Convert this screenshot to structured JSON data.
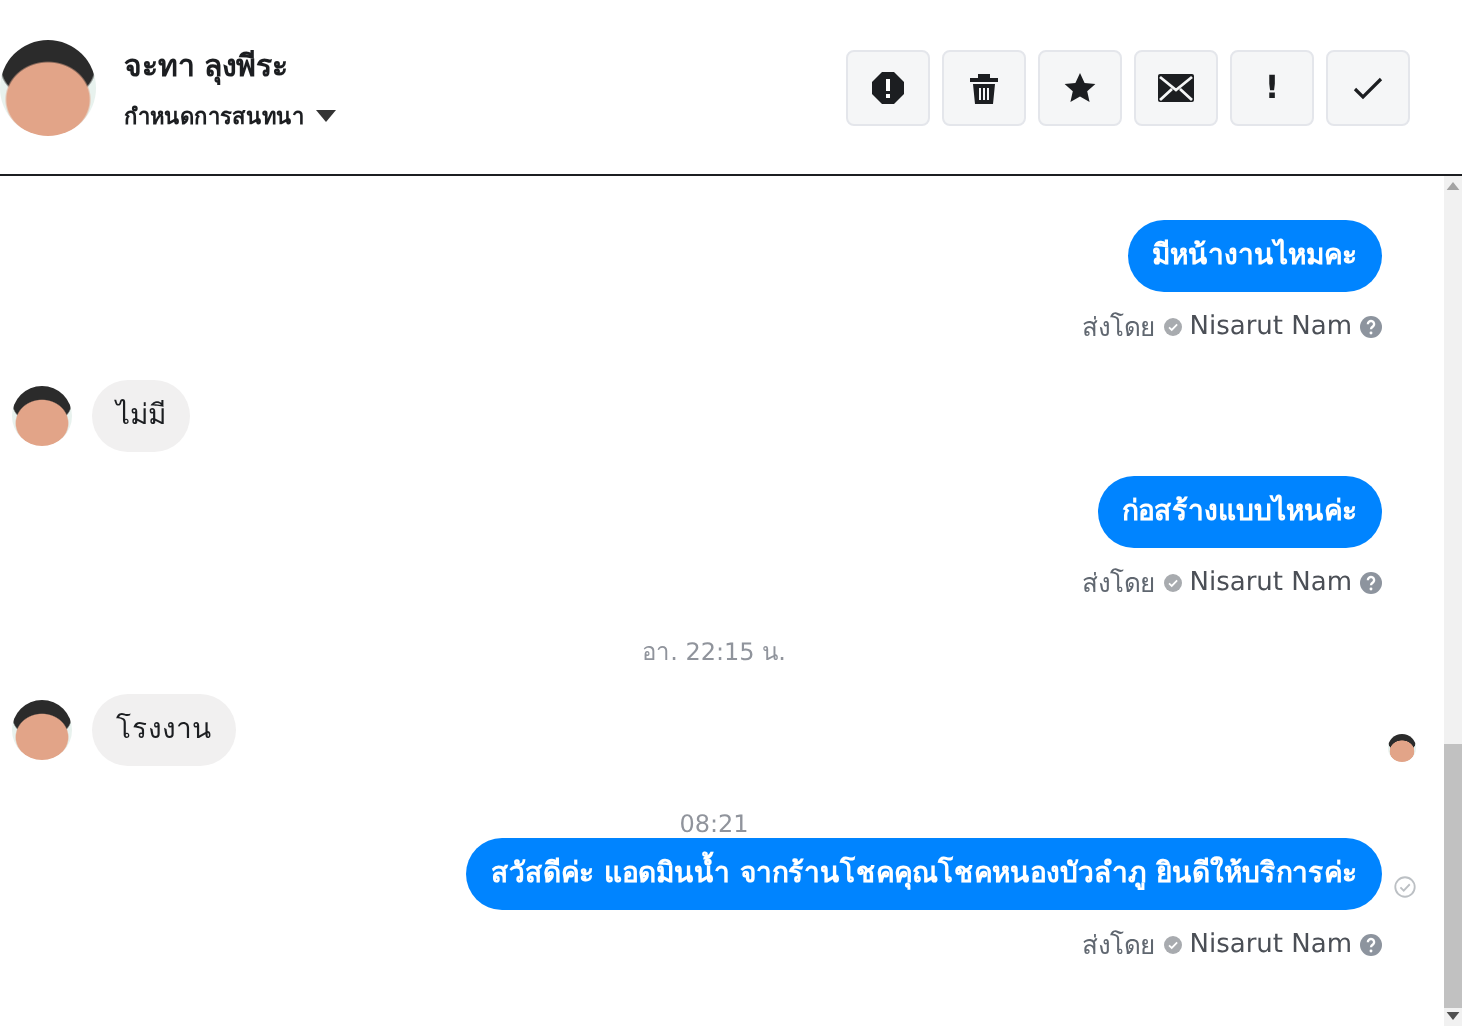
{
  "contact": {
    "name": "จะทา ลุงพีระ",
    "subtitle": "กำหนดการสนทนา"
  },
  "actions": [
    {
      "kind": "spam"
    },
    {
      "kind": "delete"
    },
    {
      "kind": "star"
    },
    {
      "kind": "mail"
    },
    {
      "kind": "text",
      "label": "!"
    },
    {
      "kind": "done"
    }
  ],
  "messages": [
    {
      "kind": "out",
      "text": "มีหน้างานไหมคะ",
      "sender_label": "ส่งโดย",
      "sender": "Nisarut Nam",
      "seen": false
    },
    {
      "kind": "in",
      "text": "ไม่มี",
      "read_marker": false
    },
    {
      "kind": "out",
      "text": "ก่อสร้างแบบไหนค่ะ",
      "sender_label": "ส่งโดย",
      "sender": "Nisarut Nam",
      "seen": false
    },
    {
      "kind": "time",
      "text": "อา. 22:15 น."
    },
    {
      "kind": "in",
      "text": "โรงงาน",
      "read_marker": true
    },
    {
      "kind": "time",
      "text": "08:21"
    },
    {
      "kind": "out",
      "text": "สวัสดีค่ะ แอดมินน้ำ จากร้านโชคคุณโชคหนองบัวลำภู ยินดีให้บริการค่ะ",
      "sender_label": "ส่งโดย",
      "sender": "Nisarut Nam",
      "seen": true
    }
  ]
}
